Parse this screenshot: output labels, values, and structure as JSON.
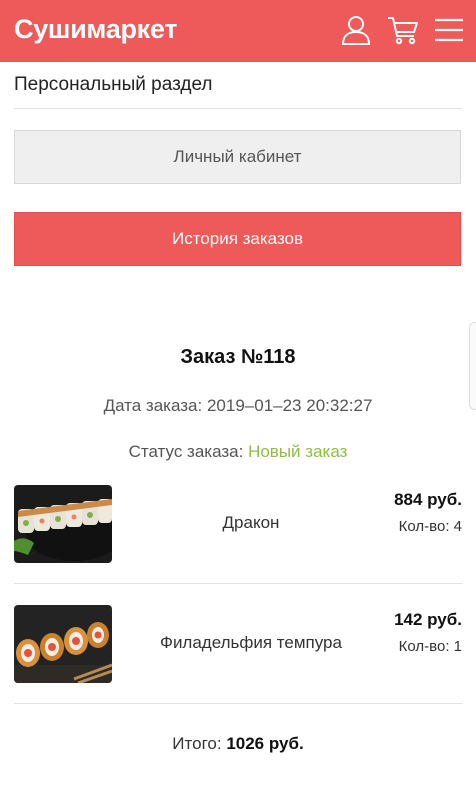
{
  "header": {
    "logo": "Сушимаркет",
    "icons": [
      "user-icon",
      "cart-icon",
      "menu-icon"
    ],
    "background": "#ee5a5a"
  },
  "section": {
    "title": "Персональный раздел"
  },
  "buttons": {
    "cabinet": "Личный кабинет",
    "history": "История заказов"
  },
  "order": {
    "title": "Заказ №118",
    "date_label": "Дата заказа:",
    "date_value": "2019–01–23 20:32:27",
    "status_label": "Статус заказа:",
    "status_value": "Новый заказ",
    "status_color": "#8fbc45",
    "items": [
      {
        "name": "Дракон",
        "price": "884 руб.",
        "qty": "Кол-во: 4"
      },
      {
        "name": "Филадельфия темпура",
        "price": "142 руб.",
        "qty": "Кол-во: 1"
      }
    ],
    "total_label": "Итого:",
    "total_value": "1026 руб."
  }
}
